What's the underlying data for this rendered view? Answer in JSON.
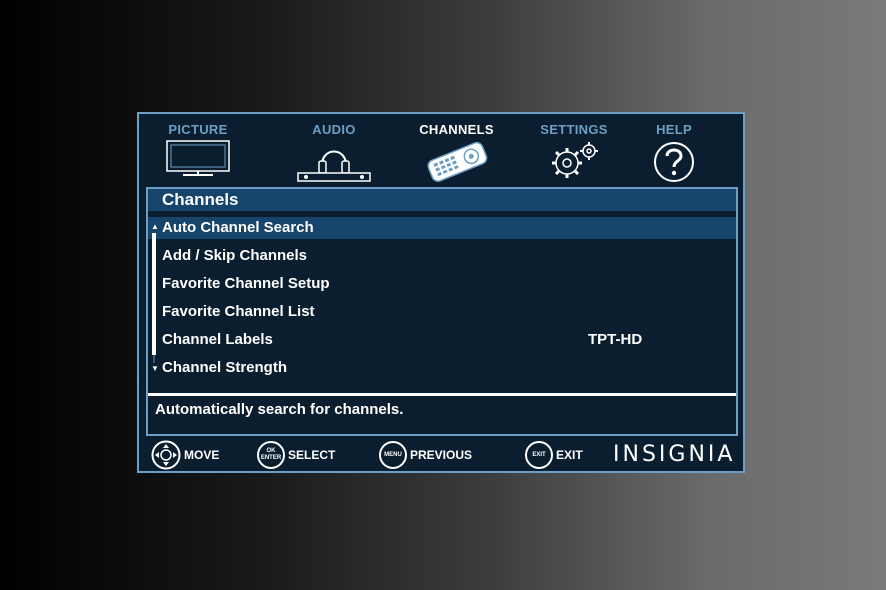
{
  "tabs": [
    {
      "label": "PICTURE",
      "icon": "tv-icon",
      "active": false
    },
    {
      "label": "AUDIO",
      "icon": "headphones-icon",
      "active": false
    },
    {
      "label": "CHANNELS",
      "icon": "remote-icon",
      "active": true
    },
    {
      "label": "SETTINGS",
      "icon": "gears-icon",
      "active": false
    },
    {
      "label": "HELP",
      "icon": "question-icon",
      "active": false
    }
  ],
  "panel": {
    "title": "Channels",
    "items": [
      {
        "label": "Auto Channel Search",
        "value": "",
        "selected": true
      },
      {
        "label": "Add / Skip Channels",
        "value": ""
      },
      {
        "label": "Favorite Channel Setup",
        "value": ""
      },
      {
        "label": "Favorite Channel List",
        "value": ""
      },
      {
        "label": "Channel Labels",
        "value": "TPT-HD"
      },
      {
        "label": "Channel Strength",
        "value": ""
      }
    ],
    "help_text": "Automatically search for channels."
  },
  "footer": {
    "move": {
      "label": "MOVE",
      "icon": "dpad-icon"
    },
    "select": {
      "label": "SELECT",
      "btn_top": "OK",
      "btn_bottom": "ENTER"
    },
    "previous": {
      "label": "PREVIOUS",
      "btn": "MENU"
    },
    "exit": {
      "label": "EXIT",
      "btn": "EXIT"
    },
    "brand": "INSIGNIA"
  },
  "colors": {
    "accent": "#6d9fc4",
    "background": "#0b1e2f",
    "highlight": "#17446b",
    "text": "#ffffff"
  }
}
